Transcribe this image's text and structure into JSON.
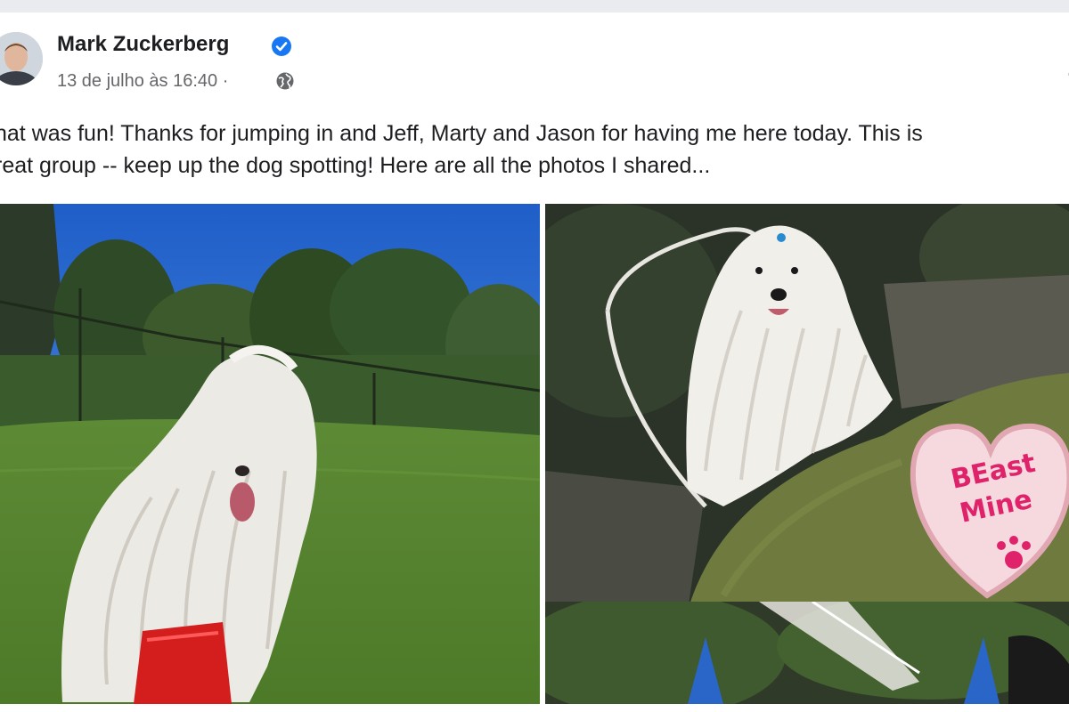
{
  "post": {
    "author": "Mark Zuckerberg",
    "verified_icon": "verified-badge-icon",
    "timestamp": "13 de julho às 16:40 ·",
    "audience_icon": "globe-icon",
    "menu_glyph": "·",
    "text_lines": [
      "hat was fun! Thanks for jumping in and Jeff, Marty and Jason for having me here today. This is",
      "reat group -- keep up the dog spotting! Here are all the photos I shared..."
    ]
  },
  "photos": [
    {
      "name": "white-corded-dog-in-park-photo"
    },
    {
      "name": "white-dog-with-heart-cookie-photo"
    },
    {
      "name": "dogs-in-costume-photo"
    }
  ],
  "cookie_text": [
    "BEast",
    "Mine"
  ],
  "colors": {
    "brand_blue": "#1877f2",
    "text": "#1c1e21",
    "secondary_text": "#65676b"
  }
}
